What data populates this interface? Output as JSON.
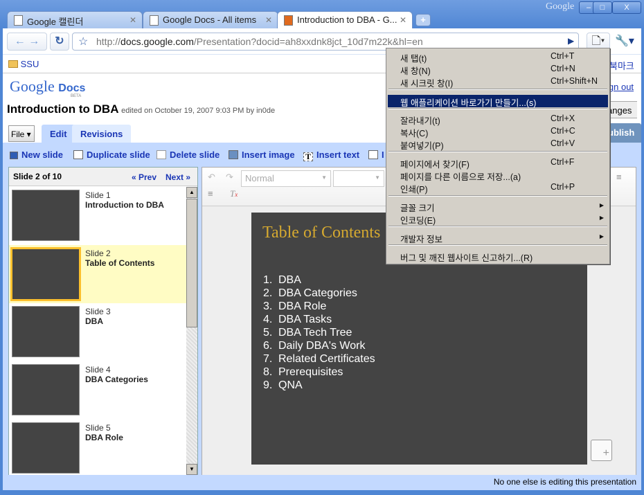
{
  "window": {
    "brand": "Google",
    "min": "‒",
    "max": "□",
    "close": "X"
  },
  "tabs": [
    {
      "label": "Google 캘린더"
    },
    {
      "label": "Google Docs - All items"
    },
    {
      "label": "Introduction to DBA - G..."
    }
  ],
  "new_tab": "+",
  "address": {
    "prefix": "http://",
    "domain": "docs.google.com",
    "path": "/Presentation?docid=ah8xxdnk8jct_10d7m22k&hl=en"
  },
  "bookmarks": {
    "folder": "SSU",
    "other": "북마크"
  },
  "page": {
    "logo": "Google",
    "logo_docs": "Docs",
    "logo_beta": "BETA",
    "sign_out": "ign out",
    "title": "Introduction to DBA",
    "edited": "edited on October 19, 2007 9:03 PM by in0de",
    "save_changes": "anges",
    "publish": "ublish"
  },
  "doc_tabs": {
    "file": "File ▾",
    "edit": "Edit",
    "revisions": "Revisions"
  },
  "actions": {
    "new_slide": "New slide",
    "duplicate_slide": "Duplicate slide",
    "delete_slide": "Delete slide",
    "insert_image": "Insert image",
    "insert_text": "Insert text",
    "more": "I"
  },
  "slides_panel": {
    "counter": "Slide 2 of 10",
    "prev": "« Prev",
    "next": "Next »",
    "slides": [
      {
        "num": "Slide 1",
        "title": "Introduction to DBA"
      },
      {
        "num": "Slide 2",
        "title": "Table of Contents",
        "selected": true
      },
      {
        "num": "Slide 3",
        "title": "DBA"
      },
      {
        "num": "Slide 4",
        "title": "DBA Categories"
      },
      {
        "num": "Slide 5",
        "title": "DBA Role"
      }
    ]
  },
  "editor": {
    "style_select": "Normal",
    "font_select": ""
  },
  "slide": {
    "title": "Table of Contents",
    "items": [
      {
        "n": "1.",
        "t": "DBA"
      },
      {
        "n": "2.",
        "t": "DBA Categories"
      },
      {
        "n": "3.",
        "t": "DBA Role"
      },
      {
        "n": "4.",
        "t": "DBA Tasks"
      },
      {
        "n": "5.",
        "t": "DBA Tech Tree"
      },
      {
        "n": "6.",
        "t": "Daily DBA's Work"
      },
      {
        "n": "7.",
        "t": "Related Certificates"
      },
      {
        "n": "8.",
        "t": "Prerequisites"
      },
      {
        "n": "9.",
        "t": "QNA"
      }
    ]
  },
  "status": "No one else is editing this presentation",
  "menu": {
    "items": [
      {
        "label": "새 탭(t)",
        "shortcut": "Ctrl+T"
      },
      {
        "label": "새 창(N)",
        "shortcut": "Ctrl+N"
      },
      {
        "label": "새 시크릿 창(I)",
        "shortcut": "Ctrl+Shift+N"
      },
      {
        "label": "웹 애플리케이션 바로가기 만들기...(s)",
        "shortcut": "",
        "highlighted": true
      },
      {
        "label": "잘라내기(t)",
        "shortcut": "Ctrl+X"
      },
      {
        "label": "복사(C)",
        "shortcut": "Ctrl+C"
      },
      {
        "label": "붙여넣기(P)",
        "shortcut": "Ctrl+V"
      },
      {
        "label": "페이지에서 찾기(F)",
        "shortcut": "Ctrl+F"
      },
      {
        "label": "페이지를 다른 이름으로 저장...(a)",
        "shortcut": ""
      },
      {
        "label": "인쇄(P)",
        "shortcut": "Ctrl+P"
      },
      {
        "label": "글꼴 크기",
        "submenu": true
      },
      {
        "label": "인코딩(E)",
        "submenu": true
      },
      {
        "label": "개발자 정보",
        "submenu": true
      },
      {
        "label": "버그 및 깨진 웹사이트 신고하기...(R)",
        "shortcut": ""
      }
    ]
  },
  "colors": {
    "frame": "#4f86d4",
    "accent_blue": "#1a36b5",
    "toolbar_band": "#c3d9ff",
    "menu_highlight": "#0a246a",
    "slide_bg": "#444444",
    "slide_title": "#d5a930",
    "selected_slide": "#fffcc4"
  }
}
